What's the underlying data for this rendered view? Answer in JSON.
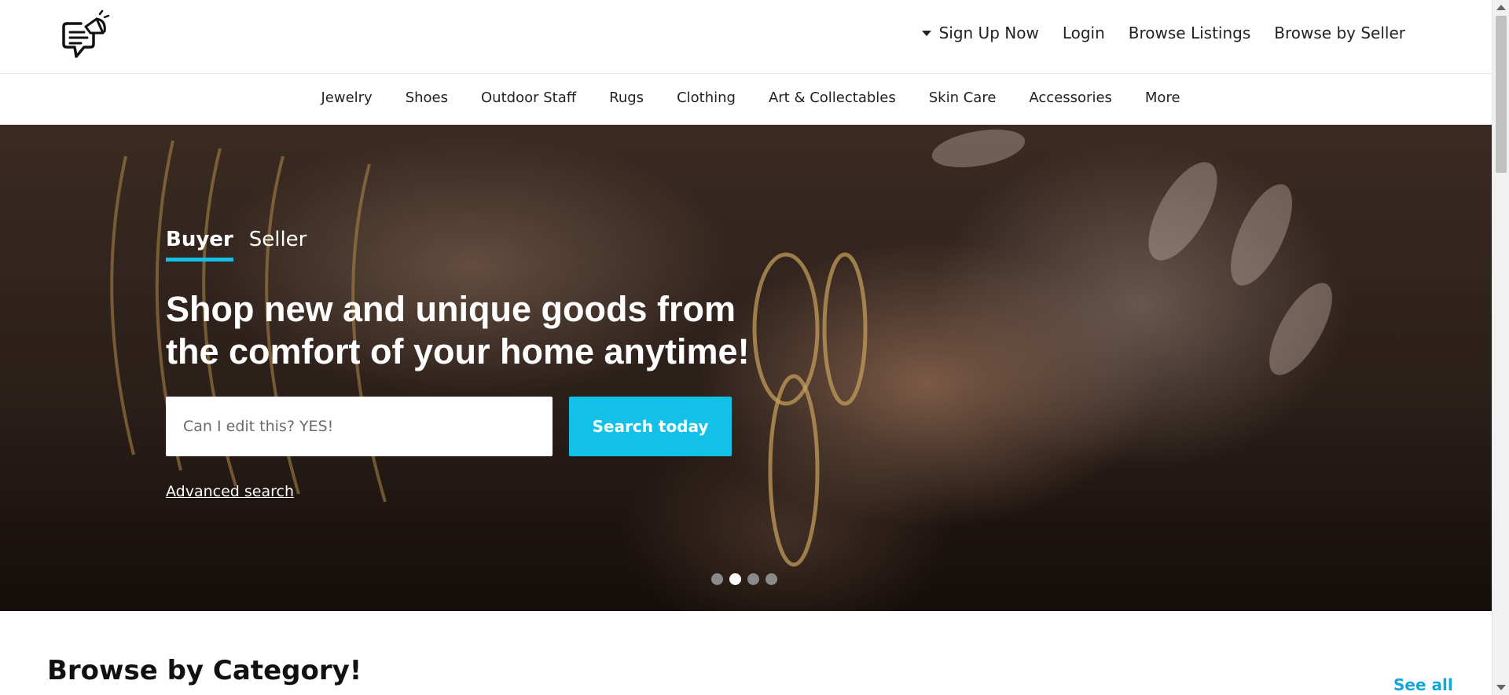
{
  "header": {
    "logo_icon": "chat-megaphone-logo-icon",
    "nav": [
      {
        "label": "Sign Up Now",
        "icon": "caret-down-icon"
      },
      {
        "label": "Login"
      },
      {
        "label": "Browse Listings"
      },
      {
        "label": "Browse by Seller"
      }
    ]
  },
  "categories": [
    "Jewelry",
    "Shoes",
    "Outdoor Staff",
    "Rugs",
    "Clothing",
    "Art & Collectables",
    "Skin Care",
    "Accessories",
    "More"
  ],
  "hero": {
    "tabs": [
      {
        "label": "Buyer",
        "active": true
      },
      {
        "label": "Seller",
        "active": false
      }
    ],
    "headline": "Shop new and unique goods from the comfort of your home anytime!",
    "search": {
      "placeholder": "Can I edit this? YES!",
      "value": ""
    },
    "search_button": "Search today",
    "advanced_link": "Advanced search",
    "carousel": {
      "count": 4,
      "active_index": 1
    }
  },
  "browse": {
    "title": "Browse by Category!",
    "see_all": "See all"
  },
  "colors": {
    "accent": "#12c0e8",
    "link": "#12a8d6",
    "text": "#222222"
  }
}
